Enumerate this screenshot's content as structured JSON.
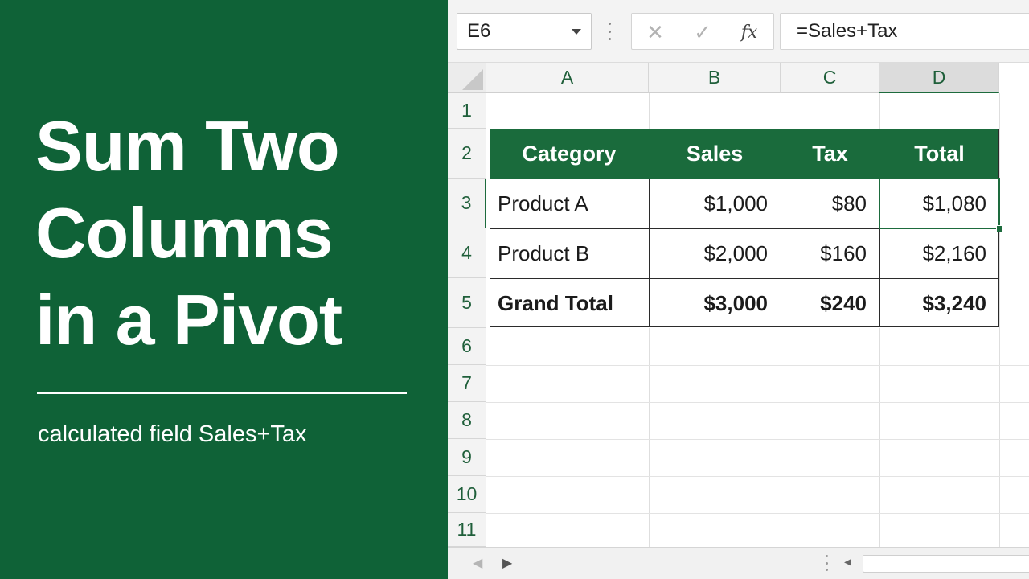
{
  "panel": {
    "title_lines": [
      "Sum Two",
      "Columns",
      "in a Pivot"
    ],
    "subtitle": "calculated field Sales+Tax"
  },
  "formula_bar": {
    "name_box": "E6",
    "formula": "=Sales+Tax",
    "fx_label": "fx",
    "cancel_glyph": "✕",
    "enter_glyph": "✓"
  },
  "columns": [
    "A",
    "B",
    "C",
    "D"
  ],
  "selected_column": "D",
  "rows": [
    "1",
    "2",
    "3",
    "4",
    "5",
    "6",
    "7",
    "8",
    "9",
    "10",
    "11"
  ],
  "pivot": {
    "headers": [
      "Category",
      "Sales",
      "Tax",
      "Total"
    ],
    "rows": [
      {
        "category": "Product A",
        "sales": "$1,000",
        "tax": "$80",
        "total": "$1,080"
      },
      {
        "category": "Product B",
        "sales": "$2,000",
        "tax": "$160",
        "total": "$2,160"
      }
    ],
    "grand_total": {
      "category": "Grand Total",
      "sales": "$3,000",
      "tax": "$240",
      "total": "$3,240"
    }
  },
  "colors": {
    "panel_green": "#0f6237",
    "header_green": "#1a6b3c",
    "selection_green": "#1d6b3d",
    "text_white": "#ffffff"
  },
  "icons": {
    "name_box_dropdown": "chevron-down-icon",
    "cancel": "close-icon",
    "enter": "check-icon",
    "function": "fx-icon",
    "prev_sheet": "triangle-left-icon",
    "next_sheet": "triangle-right-icon"
  }
}
